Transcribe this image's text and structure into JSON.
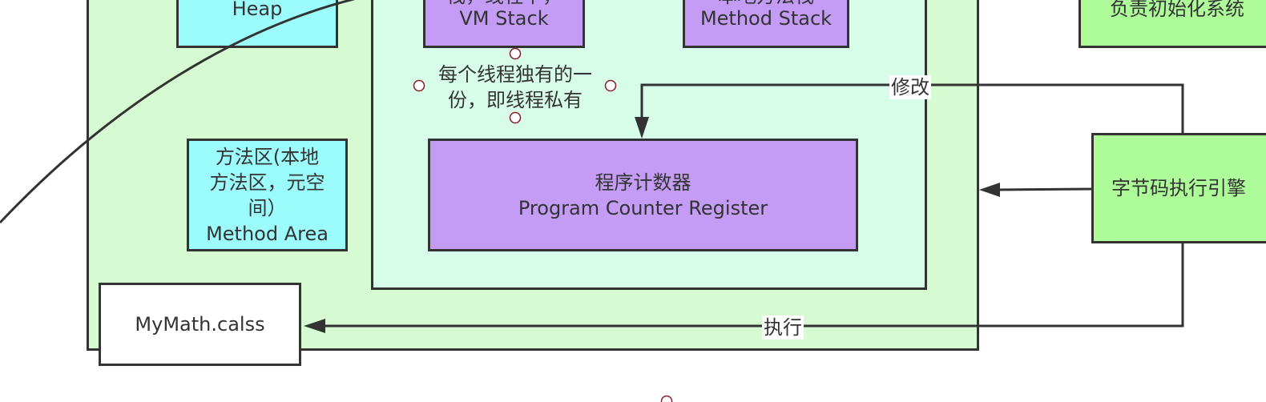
{
  "colors": {
    "stroke": "#333333",
    "runtime_area_fill": "#d6fad1",
    "thread_area_fill": "#d7fdea",
    "heap_fill": "#9cfcfc",
    "stack_fill": "#c49cf5",
    "engine_fill": "#aefb9a",
    "handle_stroke": "#8b1a2b"
  },
  "nodes": {
    "heap": {
      "line1": "Heap"
    },
    "vm_stack": {
      "line1": "栈，线程中，",
      "line2": "VM Stack"
    },
    "native_method_stack": {
      "line1": "本地方法栈",
      "line2": "Method Stack"
    },
    "top_right": {
      "line1": "负责初始化系统"
    },
    "method_area": {
      "line1": "方法区(本地",
      "line2": "方法区，元空",
      "line3": "间）",
      "line4": "Method Area"
    },
    "pc_register": {
      "line1": "程序计数器",
      "line2": "Program Counter Register"
    },
    "mymath_class": {
      "line1": "MyMath.calss"
    },
    "bytecode_engine": {
      "line1": "字节码执行引擎"
    }
  },
  "thread_note": {
    "line1": "每个线程独有的一",
    "line2": "份，即线程私有"
  },
  "edges": {
    "modify": {
      "label": "修改"
    },
    "execute": {
      "label": "执行"
    }
  }
}
